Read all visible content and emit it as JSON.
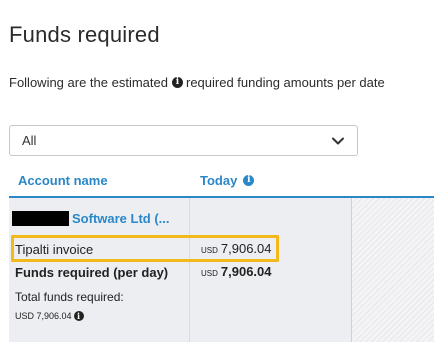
{
  "page": {
    "title": "Funds required",
    "subtitle_before": "Following are the estimated",
    "subtitle_after": "required funding amounts per date"
  },
  "filter": {
    "selected": "All"
  },
  "table": {
    "columns": {
      "account_name": "Account name",
      "today": "Today"
    },
    "account": {
      "name": "Software Ltd (..."
    },
    "rows": [
      {
        "label": "Tipalti invoice",
        "currency": "USD",
        "amount": "7,906.04"
      },
      {
        "label": "Funds required (per day)",
        "currency": "USD",
        "amount": "7,906.04"
      }
    ],
    "total": {
      "label": "Total funds required:",
      "value": "USD 7,906.04"
    }
  },
  "colors": {
    "accent": "#2a87c8",
    "highlight": "#f3b91b",
    "table_bg": "#edeef2"
  },
  "icons": {
    "info": "info-icon",
    "dropdown": "chevron-down-icon"
  }
}
